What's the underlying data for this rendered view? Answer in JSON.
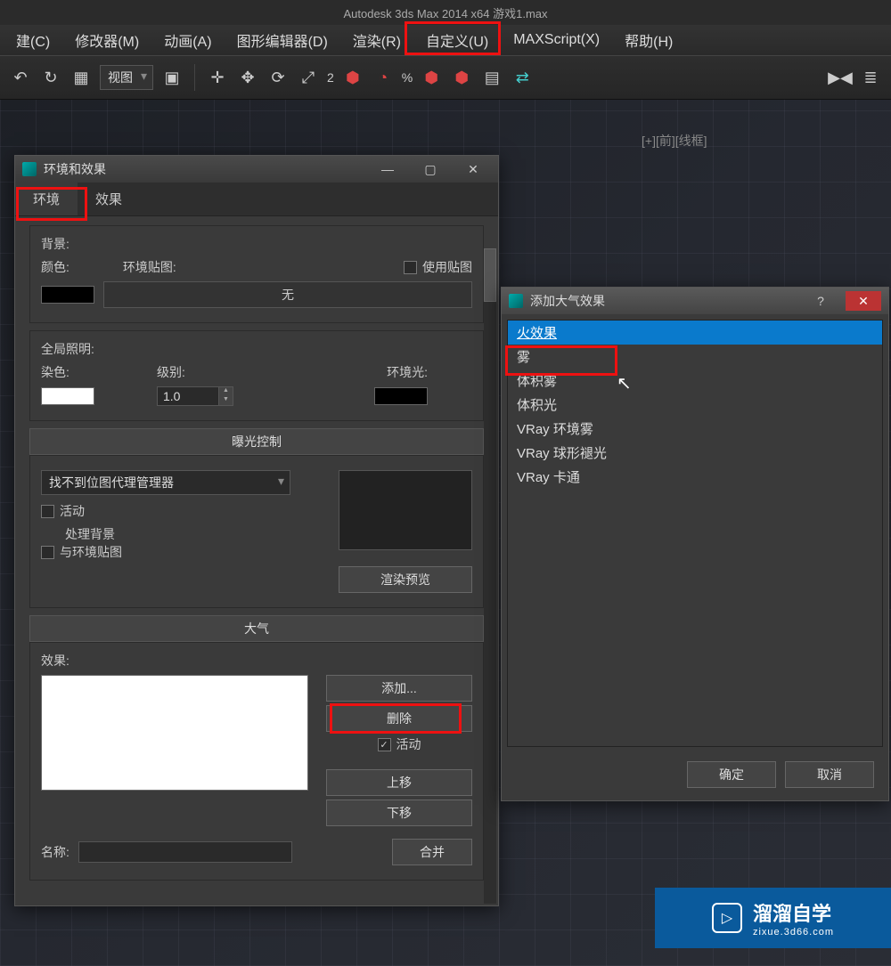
{
  "app_title": "Autodesk 3ds Max 2014 x64    游戏1.max",
  "menu": [
    "建(C)",
    "修改器(M)",
    "动画(A)",
    "图形编辑器(D)",
    "渲染(R)",
    "自定义(U)",
    "MAXScript(X)",
    "帮助(H)"
  ],
  "toolbar": {
    "views_label": "视图",
    "two": "2",
    "percent": "%"
  },
  "viewport_label": "[+][前][线框]",
  "env_dialog": {
    "title": "环境和效果",
    "tabs": {
      "env": "环境",
      "effects": "效果"
    },
    "bg_section": {
      "header": "背景:",
      "color_label": "颜色:",
      "env_map_label": "环境贴图:",
      "use_map_label": "使用贴图",
      "none_btn": "无"
    },
    "global_section": {
      "header": "全局照明:",
      "tint_label": "染色:",
      "level_label": "级别:",
      "level_value": "1.0",
      "ambient_label": "环境光:"
    },
    "exposure": {
      "rollout": "曝光控制",
      "dropdown": "找不到位图代理管理器",
      "active": "活动",
      "process_bg": "处理背景",
      "with_env": "与环境贴图",
      "render_preview": "渲染预览"
    },
    "atmo": {
      "rollout": "大气",
      "effects_label": "效果:",
      "add": "添加...",
      "delete": "删除",
      "active": "活动",
      "move_up": "上移",
      "move_down": "下移",
      "merge": "合并",
      "name_label": "名称:"
    }
  },
  "add_atmo": {
    "title": "添加大气效果",
    "items": [
      "火效果",
      "雾",
      "体积雾",
      "体积光",
      "VRay 环境雾",
      "VRay 球形褪光",
      "VRay 卡通"
    ],
    "ok": "确定",
    "cancel": "取消"
  },
  "watermark": {
    "name": "溜溜自学",
    "url": "zixue.3d66.com"
  }
}
